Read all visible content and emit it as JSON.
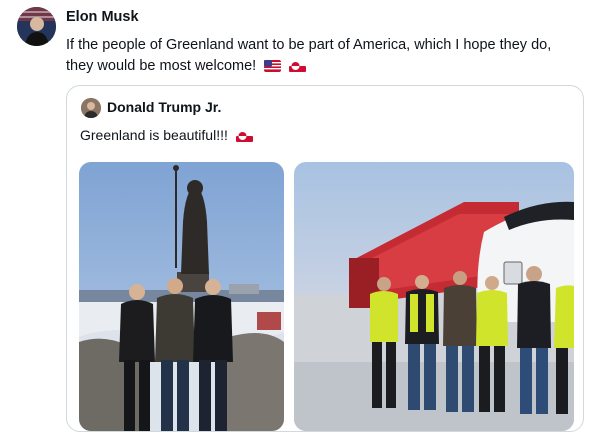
{
  "post": {
    "author": "Elon Musk",
    "text": "If the people of Greenland want to be part of America, which I hope they do, they would be most welcome!",
    "emoji": [
      "us-flag",
      "greenland-flag"
    ]
  },
  "quoted_post": {
    "author": "Donald Trump Jr.",
    "text": "Greenland is beautiful!!!",
    "emoji": [
      "greenland-flag"
    ],
    "photos": [
      "statue-group-photo",
      "helicopter-group-photo"
    ]
  },
  "colors": {
    "text": "#0f1419",
    "border": "#cfd9de",
    "greenland_red": "#d00c33",
    "sky_left": "#8fb0d8",
    "sky_right": "#b9cde6",
    "vest": "#cfe42a"
  }
}
